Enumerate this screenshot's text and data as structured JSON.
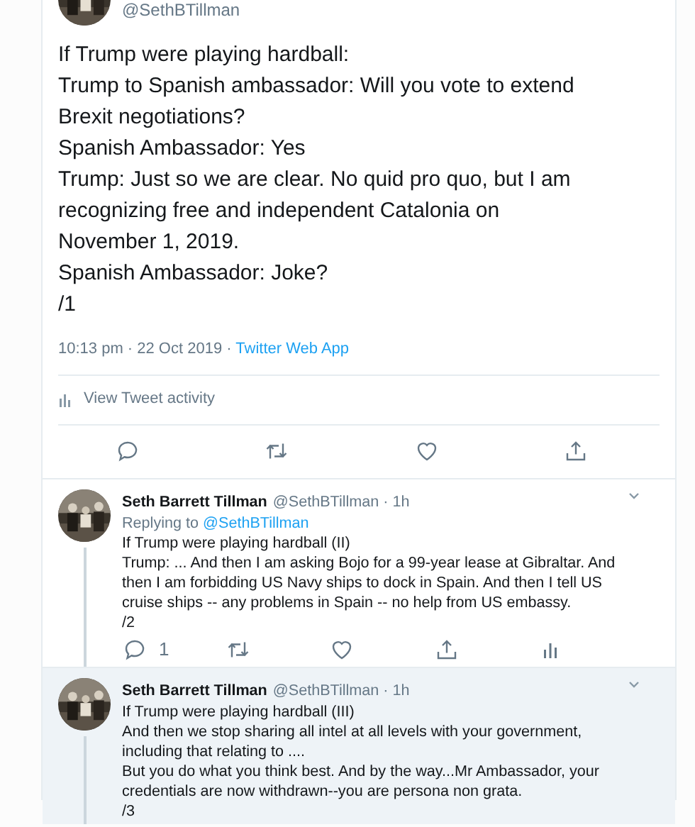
{
  "main_tweet": {
    "handle": "@SethBTillman",
    "lines": [
      "If Trump were playing hardball:",
      "Trump to Spanish ambassador: Will you vote to extend Brexit negotiations?",
      "Spanish Ambassador: Yes",
      "Trump: Just so we are clear. No quid pro quo, but I am recognizing free and independent Catalonia on November 1, 2019.",
      "Spanish Ambassador: Joke?",
      "/1"
    ],
    "time": "10:13 pm · 22 Oct 2019 · ",
    "source": "Twitter Web App",
    "activity": "View Tweet activity",
    "actions": [
      {
        "kind": "reply"
      },
      {
        "kind": "retweet"
      },
      {
        "kind": "like"
      },
      {
        "kind": "share"
      }
    ]
  },
  "replies": [
    {
      "name": "Seth Barrett Tillman",
      "handle": "@SethBTillman · 1h",
      "replying_label": "Replying to ",
      "replying_to": "@SethBTillman",
      "highlighted": false,
      "lines": [
        "If Trump were playing hardball (II)",
        "Trump: ... And then I am asking Bojo for a 99-year lease at Gibraltar. And then I am forbidding US Navy ships to dock in Spain. And then I tell US cruise ships -- any problems in Spain -- no help from US embassy.",
        "/2"
      ],
      "actions": [
        {
          "kind": "reply",
          "count": "1"
        },
        {
          "kind": "retweet"
        },
        {
          "kind": "like"
        },
        {
          "kind": "share"
        },
        {
          "kind": "analytics"
        }
      ]
    },
    {
      "name": "Seth Barrett Tillman",
      "handle": "@SethBTillman · 1h",
      "highlighted": true,
      "lines": [
        "If Trump were playing hardball (III)",
        "And then we stop sharing all intel at all levels with your government, including that relating to ....",
        "But you do what you think best. And by the way...Mr Ambassador, your credentials are now withdrawn--you are persona non grata.",
        "/3"
      ]
    }
  ]
}
